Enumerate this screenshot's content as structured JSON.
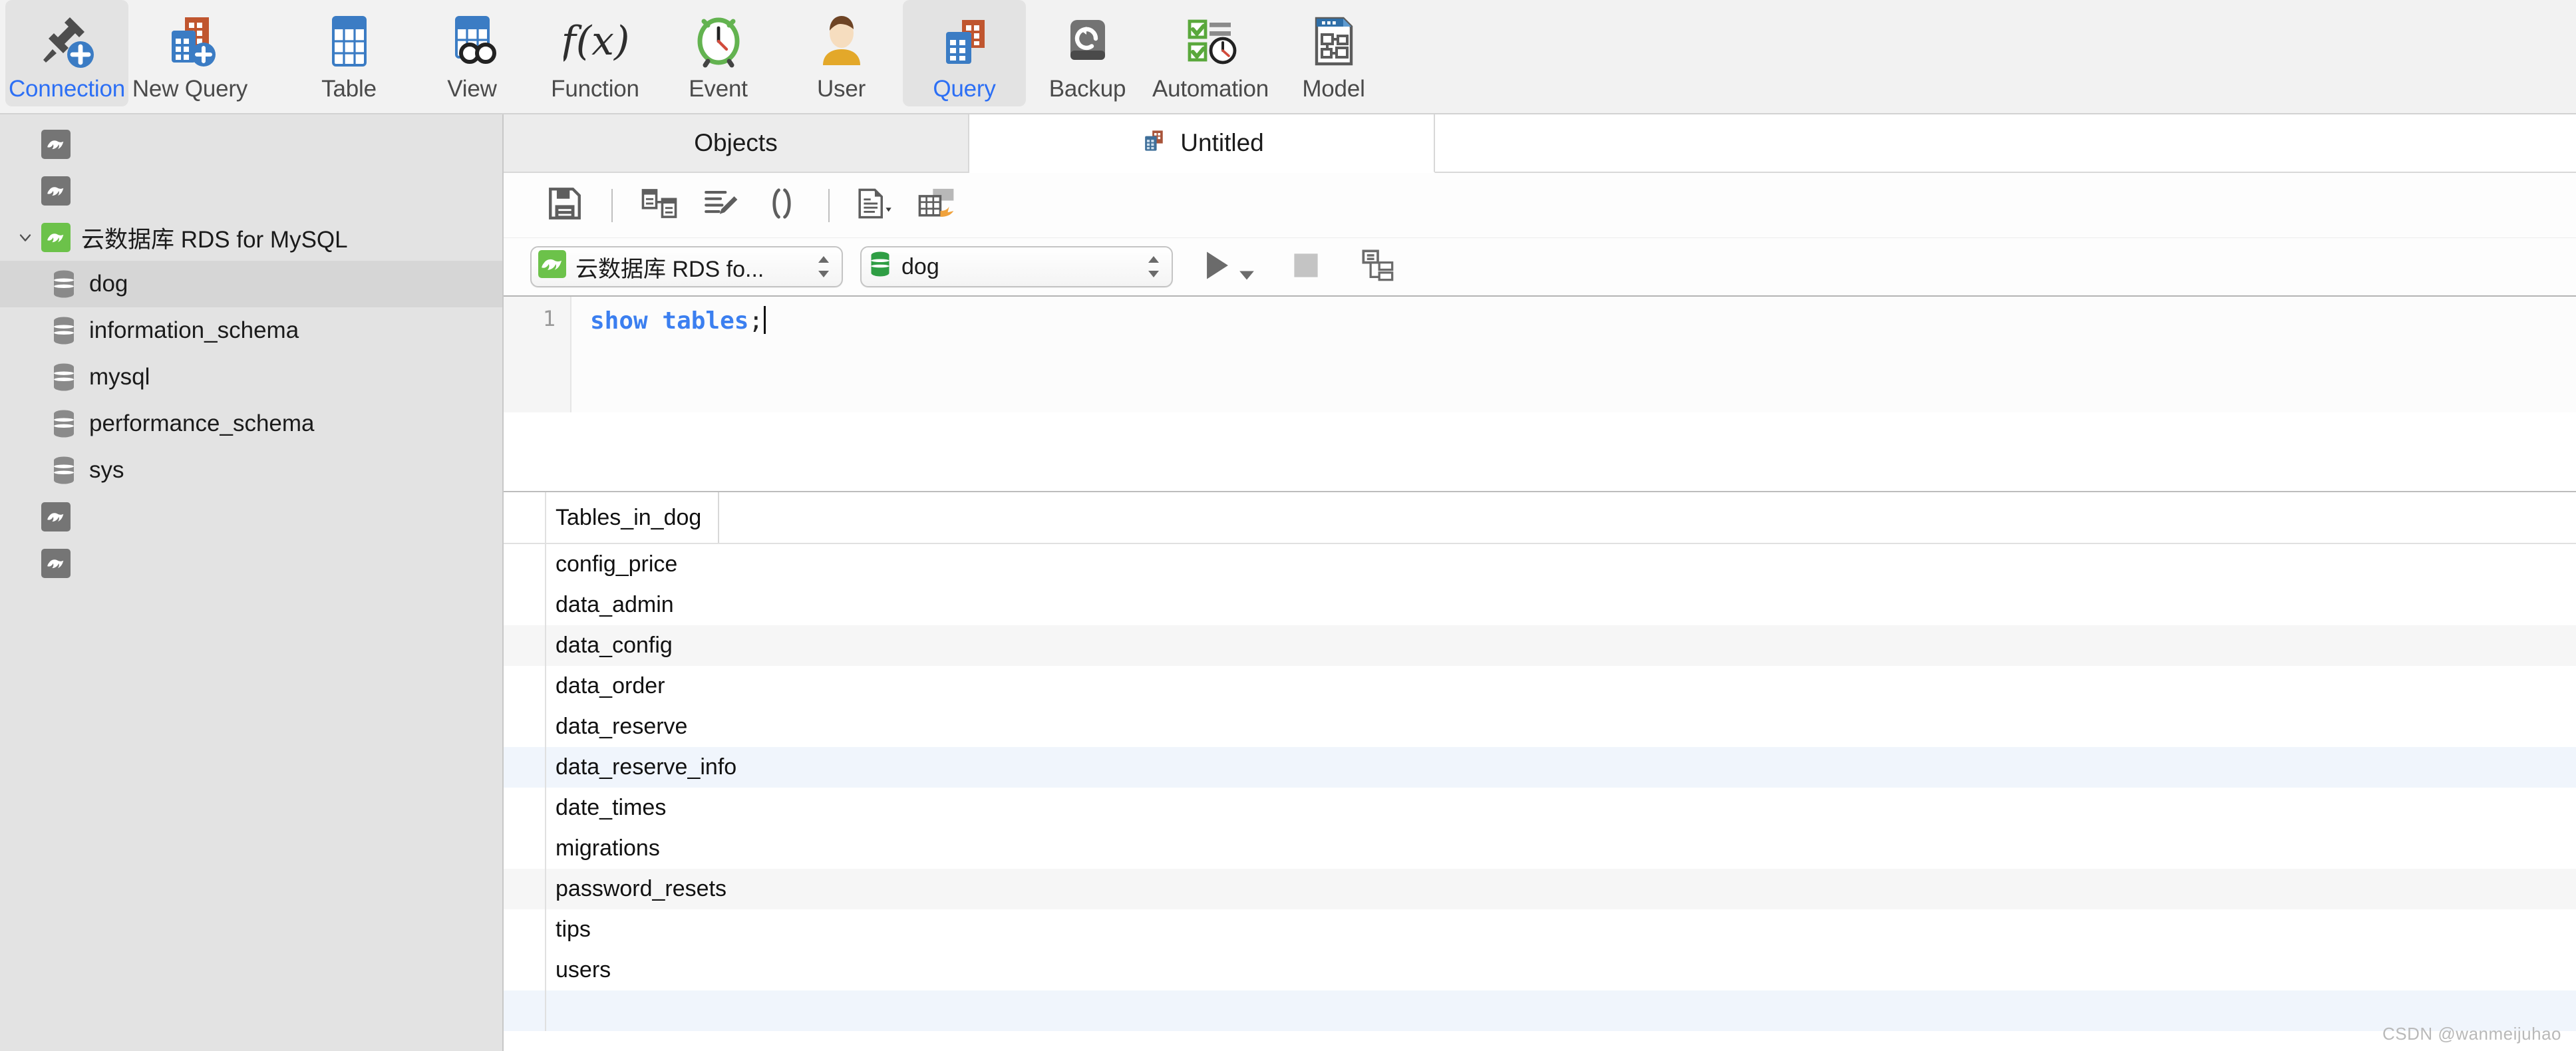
{
  "toolbar": {
    "items": [
      {
        "label": "Connection",
        "icon": "connection-add-icon",
        "active": true
      },
      {
        "label": "New Query",
        "icon": "new-query-icon",
        "active": false
      },
      {
        "label": "Table",
        "icon": "table-icon",
        "active": false
      },
      {
        "label": "View",
        "icon": "view-icon",
        "active": false
      },
      {
        "label": "Function",
        "icon": "function-icon",
        "active": false
      },
      {
        "label": "Event",
        "icon": "event-clock-icon",
        "active": false
      },
      {
        "label": "User",
        "icon": "user-icon",
        "active": false
      },
      {
        "label": "Query",
        "icon": "query-icon",
        "active": true
      },
      {
        "label": "Backup",
        "icon": "backup-restore-icon",
        "active": false
      },
      {
        "label": "Automation",
        "icon": "automation-icon",
        "active": false
      },
      {
        "label": "Model",
        "icon": "model-icon",
        "active": false
      }
    ],
    "active_accent": "#2c6ff5"
  },
  "sidebar": {
    "items": [
      {
        "label": "",
        "type": "connection",
        "state": "disconnected",
        "indent": 1,
        "selected": false
      },
      {
        "label": "",
        "type": "connection",
        "state": "disconnected",
        "indent": 1,
        "selected": false
      },
      {
        "label": "云数据库 RDS for MySQL",
        "type": "connection",
        "state": "connected",
        "indent": 1,
        "selected": false,
        "expanded": true
      },
      {
        "label": "dog",
        "type": "database",
        "indent": 2,
        "selected": true
      },
      {
        "label": "information_schema",
        "type": "database",
        "indent": 2,
        "selected": false
      },
      {
        "label": "mysql",
        "type": "database",
        "indent": 2,
        "selected": false
      },
      {
        "label": "performance_schema",
        "type": "database",
        "indent": 2,
        "selected": false
      },
      {
        "label": "sys",
        "type": "database",
        "indent": 2,
        "selected": false
      },
      {
        "label": "",
        "type": "connection",
        "state": "disconnected",
        "indent": 1,
        "selected": false
      },
      {
        "label": "",
        "type": "connection",
        "state": "disconnected",
        "indent": 1,
        "selected": false
      }
    ],
    "connected_color": "#6cc24a",
    "disconnected_color": "#757575"
  },
  "tabs": [
    {
      "label": "Objects",
      "icon": "",
      "active": false
    },
    {
      "label": "Untitled",
      "icon": "query-doc-icon",
      "active": true
    }
  ],
  "editor_toolbar": [
    {
      "name": "save-button",
      "icon": "floppy-save-icon"
    },
    {
      "name": "query-builder-button",
      "icon": "query-builder-icon"
    },
    {
      "name": "beautify-sql-button",
      "icon": "beautify-pencil-icon"
    },
    {
      "name": "code-snippet-button",
      "icon": "parentheses-icon"
    },
    {
      "name": "text-view-button",
      "icon": "document-dropdown-icon"
    },
    {
      "name": "export-result-button",
      "icon": "export-table-icon"
    }
  ],
  "connection_bar": {
    "connection_value": "云数据库 RDS fo...",
    "database_value": "dog",
    "run_label": "run-button",
    "stop_label": "stop-button",
    "stop_disabled": true,
    "explain_label": "explain-plan-button"
  },
  "sql_editor": {
    "line_number": "1",
    "keyword1": "show",
    "keyword2": "tables",
    "terminator": ";"
  },
  "result_grid": {
    "columns": [
      "Tables_in_dog"
    ],
    "rows": [
      "config_price",
      "data_admin",
      "data_config",
      "data_order",
      "data_reserve",
      "data_reserve_info",
      "date_times",
      "migrations",
      "password_resets",
      "tips",
      "users"
    ],
    "selected_row_index": 5
  },
  "watermark": "CSDN @wanmeijuhao"
}
